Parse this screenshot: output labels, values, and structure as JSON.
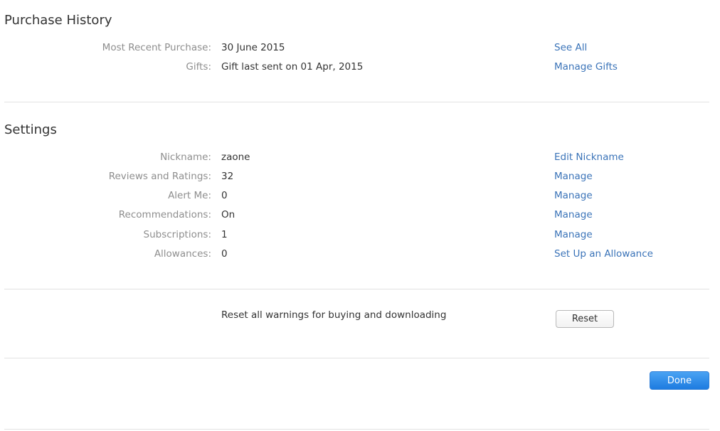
{
  "purchase_history": {
    "title": "Purchase History",
    "rows": [
      {
        "label": "Most Recent Purchase:",
        "value": "30 June 2015",
        "action": "See All"
      },
      {
        "label": "Gifts:",
        "value": "Gift last sent on 01 Apr, 2015",
        "action": "Manage Gifts"
      }
    ]
  },
  "settings": {
    "title": "Settings",
    "rows": [
      {
        "label": "Nickname:",
        "value": "zaone",
        "action": "Edit Nickname"
      },
      {
        "label": "Reviews and Ratings:",
        "value": "32",
        "action": "Manage"
      },
      {
        "label": "Alert Me:",
        "value": "0",
        "action": "Manage"
      },
      {
        "label": "Recommendations:",
        "value": "On",
        "action": "Manage"
      },
      {
        "label": "Subscriptions:",
        "value": "1",
        "action": "Manage"
      },
      {
        "label": "Allowances:",
        "value": "0",
        "action": "Set Up an Allowance"
      }
    ]
  },
  "reset_warnings": {
    "text": "Reset all warnings for buying and downloading",
    "button_label": "Reset"
  },
  "footer": {
    "done_label": "Done"
  },
  "colors": {
    "link": "#3a73b8",
    "label": "#8e8e8e",
    "primary_button": "#1d7be0"
  }
}
